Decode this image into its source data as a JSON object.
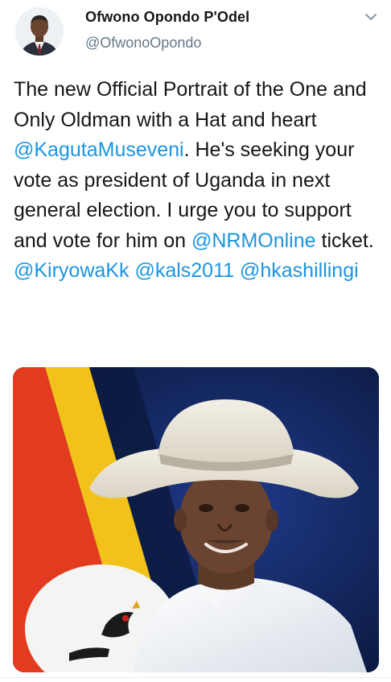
{
  "tweet": {
    "display_name": "Ofwono Opondo P'Odel",
    "handle": "@OfwonoOpondo",
    "text": {
      "p1": "The new Official Portrait of the One and Only Oldman with a Hat and heart ",
      "m1": "@KagutaMuseveni",
      "p2": ". He's seeking your vote as president of Uganda in next general election. I urge you to support and vote for him on ",
      "m2": "@NRMOnline",
      "p3": " ticket. ",
      "m3": "@KiryowaKk",
      "p4": " ",
      "m4": "@kals2011",
      "p5": " ",
      "m5": "@hkashillingi"
    },
    "icons": {
      "avatar": "user-avatar-photo",
      "menu": "chevron-down-icon"
    },
    "colors": {
      "link": "#1b95e0",
      "name": "#14171a",
      "handle": "#657786"
    }
  }
}
